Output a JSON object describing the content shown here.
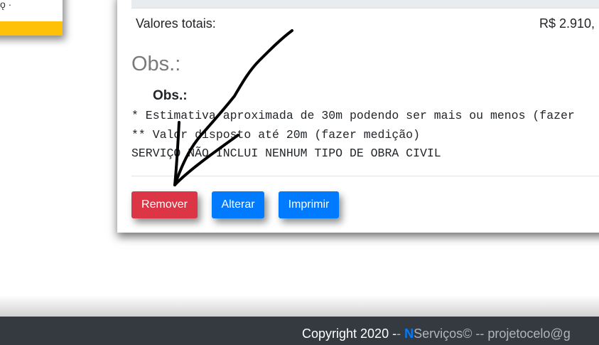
{
  "left_card": {
    "fragment": "ǫ ·"
  },
  "totals": {
    "label": "Valores totais:",
    "value": "R$ 2.910,"
  },
  "obs": {
    "heading": "Obs.:",
    "sub": "Obs.:",
    "lines": [
      "* Estimativa aproximada de 30m podendo ser mais ou menos (fazer",
      "** Valor disposto até 20m (fazer medição)",
      "SERVIÇO NÃO INCLUI NENHUM TIPO DE OBRA CIVIL"
    ]
  },
  "buttons": {
    "remove": "Remover",
    "edit": "Alterar",
    "print": "Imprimir"
  },
  "colors": {
    "danger": "#dc3545",
    "primary": "#007bff",
    "footer": "#343a40",
    "accent": "#ffc107"
  },
  "footer": {
    "prefix": "Copyright 2020 -",
    "dash": "-",
    "brand_letter": "N",
    "brand_rest": "Serviços© -- projetocelo@g"
  }
}
